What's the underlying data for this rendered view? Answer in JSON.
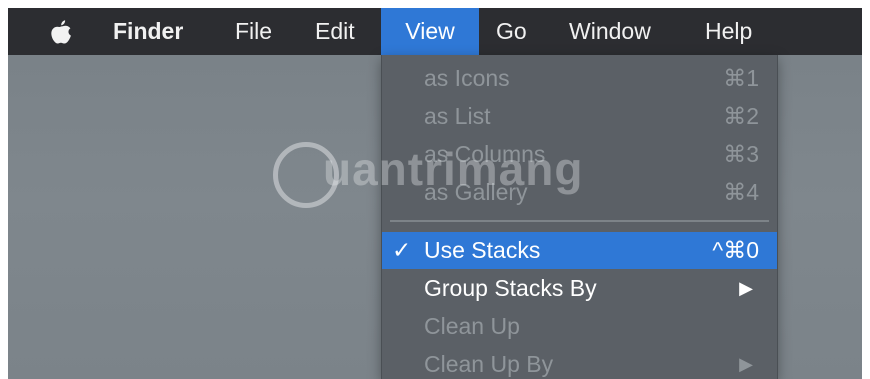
{
  "menubar": {
    "apple_icon": "apple-logo-icon",
    "items": [
      {
        "label": "Finder"
      },
      {
        "label": "File"
      },
      {
        "label": "Edit"
      },
      {
        "label": "View"
      },
      {
        "label": "Go"
      },
      {
        "label": "Window"
      },
      {
        "label": "Help"
      }
    ]
  },
  "view_menu": {
    "items": [
      {
        "label": "as Icons",
        "shortcut": "⌘1"
      },
      {
        "label": "as List",
        "shortcut": "⌘2"
      },
      {
        "label": "as Columns",
        "shortcut": "⌘3"
      },
      {
        "label": "as Gallery",
        "shortcut": "⌘4"
      },
      {
        "label": "Use Stacks",
        "shortcut": "^⌘0",
        "check": "✓"
      },
      {
        "label": "Group Stacks By",
        "arrow": "▶"
      },
      {
        "label": "Clean Up"
      },
      {
        "label": "Clean Up By",
        "arrow": "▶"
      }
    ]
  },
  "watermark": {
    "text": "uantrimang",
    "icon": "lightbulb-icon"
  },
  "colors": {
    "menubar_bg": "#2c2d31",
    "highlight": "#2f78d6",
    "menu_bg": "#5b6066",
    "desktop_bg": "#7d858b"
  }
}
